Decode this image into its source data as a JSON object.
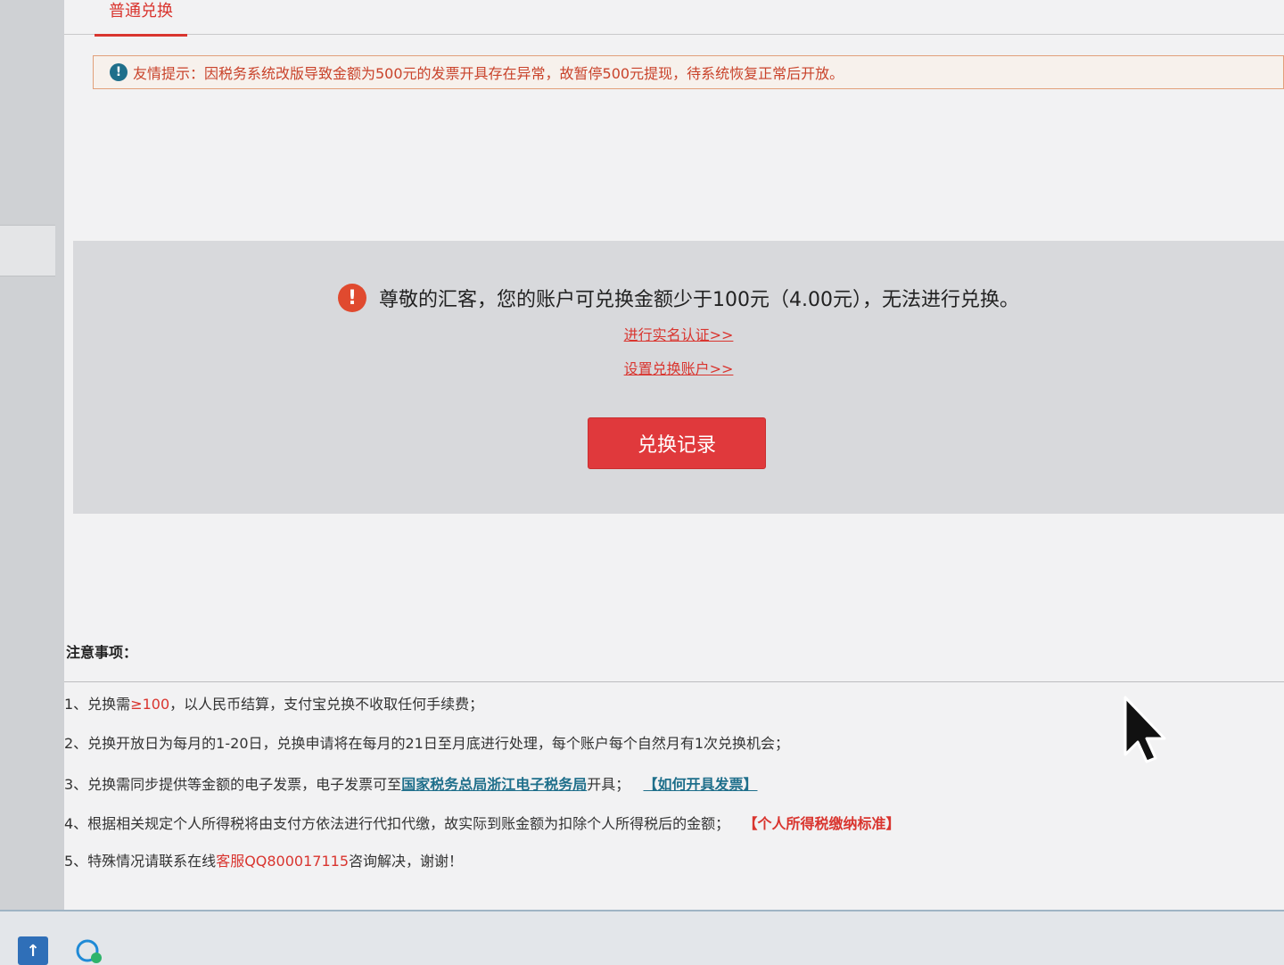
{
  "tabs": {
    "active_label": "普通兑换"
  },
  "notice": {
    "icon": "info-icon",
    "text": "友情提示：因税务系统改版导致金额为500元的发票开具存在异常，故暂停500元提现，待系统恢复正常后开放。"
  },
  "panel": {
    "warning_icon": "exclamation-icon",
    "message": "尊敬的汇客，您的账户可兑换金额少于100元（4.00元），无法进行兑换。",
    "link_verify": "进行实名认证>>",
    "link_account": "设置兑换账户>>",
    "record_button": "兑换记录"
  },
  "notes": {
    "title": "注意事项：",
    "item1": {
      "prefix": "1、兑换需",
      "highlight": "≥100",
      "suffix": "，以人民币结算，支付宝兑换不收取任何手续费；"
    },
    "item2": {
      "text": "2、兑换开放日为每月的1-20日，兑换申请将在每月的21日至月底进行处理，每个账户每个自然月有1次兑换机会；"
    },
    "item3": {
      "prefix": "3、兑换需同步提供等金额的电子发票，电子发票可至",
      "link": "国家税务总局浙江电子税务局",
      "middle": "开具；",
      "link2": "【如何开具发票】"
    },
    "item4": {
      "text": "4、根据相关规定个人所得税将由支付方依法进行代扣代缴，故实际到账金额为扣除个人所得税后的金额；",
      "link": "【个人所得税缴纳标准】"
    },
    "item5": {
      "prefix": "5、特殊情况请联系在线",
      "highlight": "客服QQ800017115",
      "suffix": "咨询解决，谢谢！"
    }
  },
  "taskbar": {
    "icon1": "app-icon",
    "icon2": "chat-icon"
  },
  "colors": {
    "accent": "#d9352f",
    "link_blue": "#1f6f8b",
    "button": "#e0393c"
  }
}
